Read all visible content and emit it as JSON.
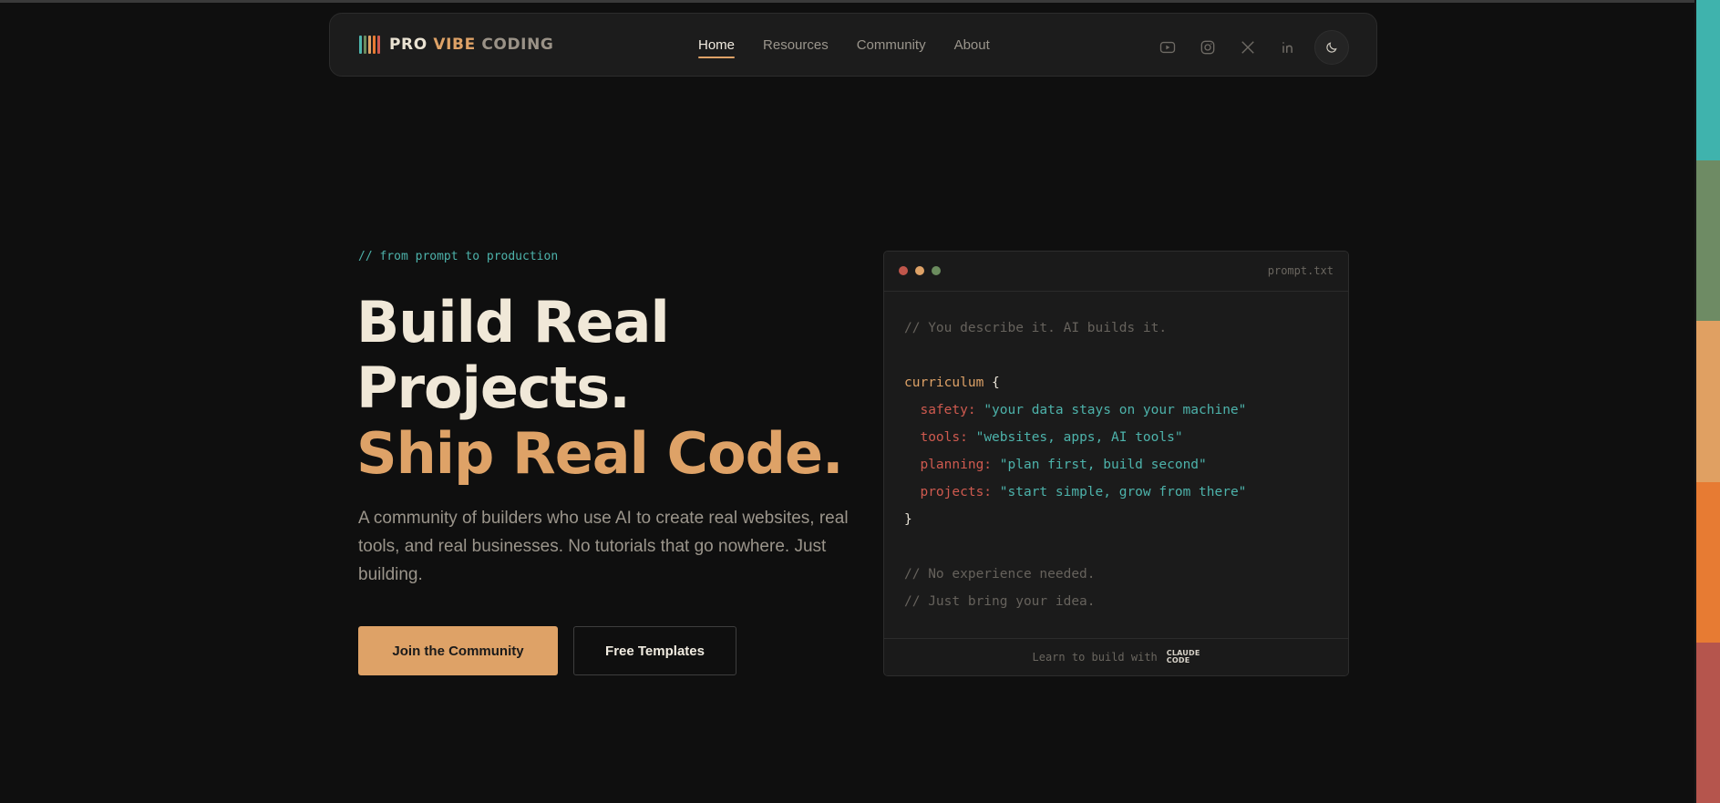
{
  "colors": {
    "background": "#0f0f0f",
    "accent": "#dea267",
    "teal": "#4db3ab",
    "red": "#cf5a4f",
    "green": "#6b8c5e",
    "strip": [
      "#3fb3ad",
      "#6e8b64",
      "#e0a062",
      "#e77b33",
      "#b5554d"
    ],
    "logo_bars": [
      "#4db3ab",
      "#6b8c5e",
      "#dea267",
      "#e77b33",
      "#cf5a4f"
    ]
  },
  "nav": {
    "logo": {
      "word1": "PRO",
      "word2": "VIBE",
      "word3": "CODING"
    },
    "links": [
      {
        "label": "Home",
        "active": true
      },
      {
        "label": "Resources",
        "active": false
      },
      {
        "label": "Community",
        "active": false
      },
      {
        "label": "About",
        "active": false
      }
    ],
    "icons": [
      "youtube-icon",
      "instagram-icon",
      "x-icon",
      "linkedin-icon",
      "moon-icon"
    ]
  },
  "hero": {
    "tagline": "// from prompt to production",
    "headline_line1": "Build Real",
    "headline_line2": "Projects.",
    "headline_line3": "Ship Real Code.",
    "description": "A community of builders who use AI to create real websites, real tools, and real businesses. No tutorials that go nowhere. Just building.",
    "primary_button": "Join the Community",
    "secondary_button": "Free Templates"
  },
  "code_window": {
    "filename": "prompt.txt",
    "comment1": "// You describe it. AI builds it.",
    "object_name": "curriculum",
    "open_brace": "{",
    "close_brace": "}",
    "entries": [
      {
        "key": "safety:",
        "value": "\"your data stays on your machine\""
      },
      {
        "key": "tools:",
        "value": "\"websites, apps, AI tools\""
      },
      {
        "key": "planning:",
        "value": "\"plan first, build second\""
      },
      {
        "key": "projects:",
        "value": "\"start simple, grow from there\""
      }
    ],
    "comment2": "// No experience needed.",
    "comment3": "// Just bring your idea.",
    "footer_text": "Learn to build with",
    "footer_logo_line1": "CLAUDE",
    "footer_logo_line2": "CODE"
  }
}
